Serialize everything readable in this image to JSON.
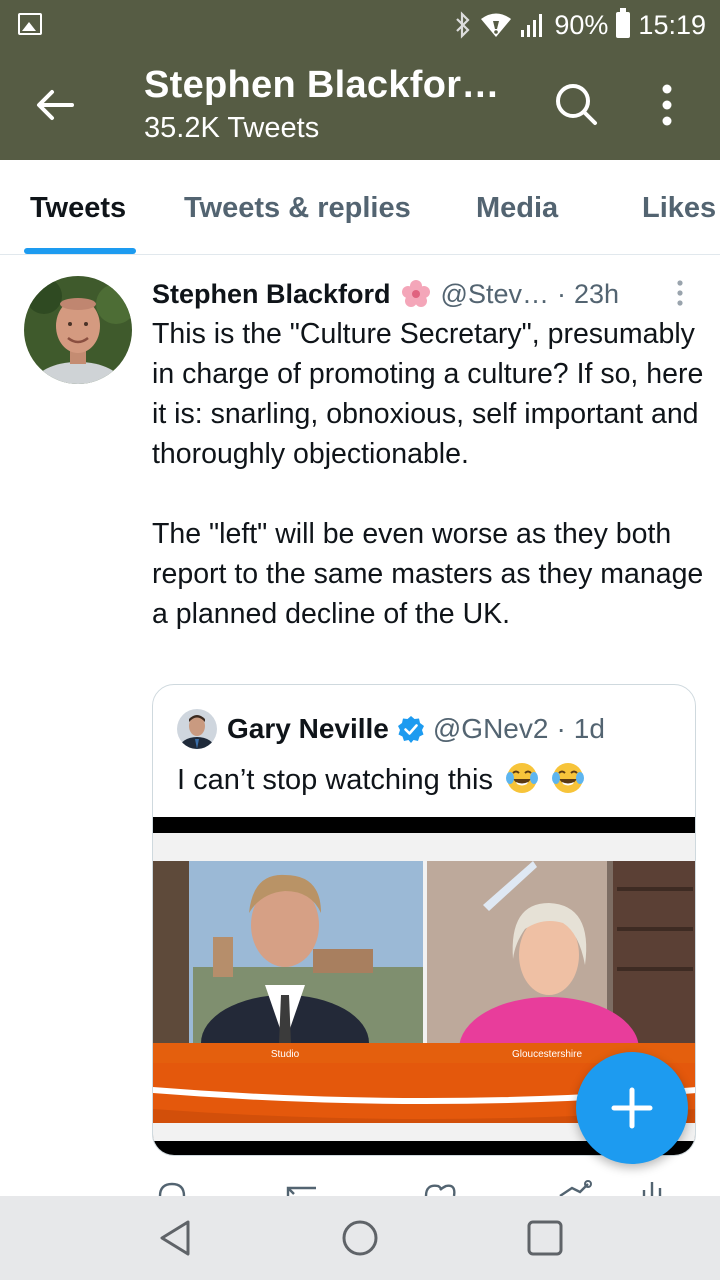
{
  "status_bar": {
    "battery_percent": "90%",
    "time": "15:19",
    "icons": [
      "image-icon",
      "bluetooth-icon",
      "wifi-icon",
      "signal-icon",
      "battery-icon"
    ]
  },
  "app_bar": {
    "title": "Stephen Blackfor…",
    "subtitle": "35.2K Tweets",
    "color": "#565c44"
  },
  "tabs": [
    {
      "label": "Tweets",
      "active": true
    },
    {
      "label": "Tweets & replies",
      "active": false
    },
    {
      "label": "Media",
      "active": false
    },
    {
      "label": "Likes",
      "active": false
    }
  ],
  "tweet": {
    "author_name": "Stephen Blackford",
    "handle": "@Stev…",
    "separator": "·",
    "time": "23h",
    "text": "This is the \"Culture Secretary\", presumably in charge of promoting a culture? If so, here it is: snarling, obnoxious, self important and thoroughly objectionable.\n\nThe \"left\" will be even worse as they both report to the same masters as they manage a planned decline of the UK."
  },
  "quoted_tweet": {
    "author_name": "Gary Neville",
    "handle": "@GNev2",
    "separator": "·",
    "time": "1d",
    "text": "I can’t stop watching this",
    "media": {
      "left_caption": "Studio",
      "right_caption": "Gloucestershire"
    }
  },
  "fab": {
    "icon": "plus-icon"
  },
  "accent_color": "#1d9bf0"
}
